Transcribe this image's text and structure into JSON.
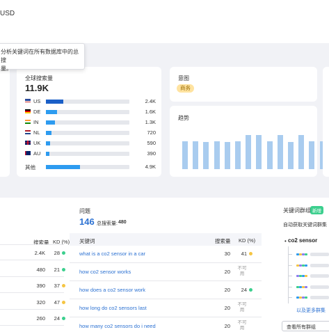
{
  "header": {
    "currency": "USD"
  },
  "tooltip": {
    "lines": [
      "分析关键词在所有数据库中的总搜",
      "量。"
    ]
  },
  "global_volume": {
    "title": "全球搜索量",
    "value": "11.9K",
    "countries": [
      {
        "code": "US",
        "value": "2.4K",
        "share": 0.21
      },
      {
        "code": "DE",
        "value": "1.6K",
        "share": 0.13
      },
      {
        "code": "IN",
        "value": "1.3K",
        "share": 0.11
      },
      {
        "code": "NL",
        "value": "720",
        "share": 0.07
      },
      {
        "code": "UK",
        "value": "590",
        "share": 0.05
      },
      {
        "code": "AU",
        "value": "390",
        "share": 0.04
      }
    ],
    "other": {
      "label": "其他",
      "value": "4.9K",
      "share": 0.41
    }
  },
  "intent": {
    "title": "意图",
    "badge": "商务"
  },
  "trend": {
    "title": "趋势",
    "values": [
      0.8,
      0.8,
      0.78,
      0.8,
      0.78,
      0.8,
      0.98,
      0.98,
      0.8,
      0.98,
      0.78,
      0.98,
      0.8,
      0.8
    ]
  },
  "left_table": {
    "headers": {
      "volume": "搜索量",
      "kd": "KD (%)"
    },
    "rows": [
      {
        "volume": "2.4K",
        "kd": "28",
        "color": "#3ccf8e"
      },
      {
        "volume": "480",
        "kd": "21",
        "color": "#3ccf8e"
      },
      {
        "volume": "390",
        "kd": "37",
        "color": "#f5c543"
      },
      {
        "volume": "320",
        "kd": "47",
        "color": "#f5c543"
      },
      {
        "volume": "260",
        "kd": "24",
        "color": "#3ccf8e"
      }
    ]
  },
  "questions": {
    "title": "问题",
    "count": "146",
    "total_label": "总搜索量:",
    "total_value": "480",
    "headers": {
      "keyword": "关键词",
      "volume": "搜索量",
      "kd": "KD (%)"
    },
    "rows": [
      {
        "keyword": "what is a co2 sensor in a car",
        "volume": "30",
        "kd": "41",
        "na": "",
        "color": "#f5c543"
      },
      {
        "keyword": "how co2 sensor works",
        "volume": "20",
        "kd": "",
        "na": "不可用",
        "color": ""
      },
      {
        "keyword": "how does a co2 sensor work",
        "volume": "20",
        "kd": "24",
        "na": "",
        "color": "#3ccf8e"
      },
      {
        "keyword": "how long do co2 sensors last",
        "volume": "20",
        "kd": "",
        "na": "不可用",
        "color": ""
      },
      {
        "keyword": "how many co2 sensors do i need",
        "volume": "20",
        "kd": "",
        "na": "不可用",
        "color": ""
      }
    ]
  },
  "clusters": {
    "title": "关键词群组",
    "badge": "新增",
    "subtitle": "自动获取关键词群集",
    "root": "co2 sensor",
    "more_link": "以及更多群集",
    "view_all": "查看所有群组"
  },
  "colors": {
    "accent": "#2d9bf0",
    "bar": "#a9ccef",
    "green": "#3ccf8e",
    "yellow": "#f5c543"
  }
}
